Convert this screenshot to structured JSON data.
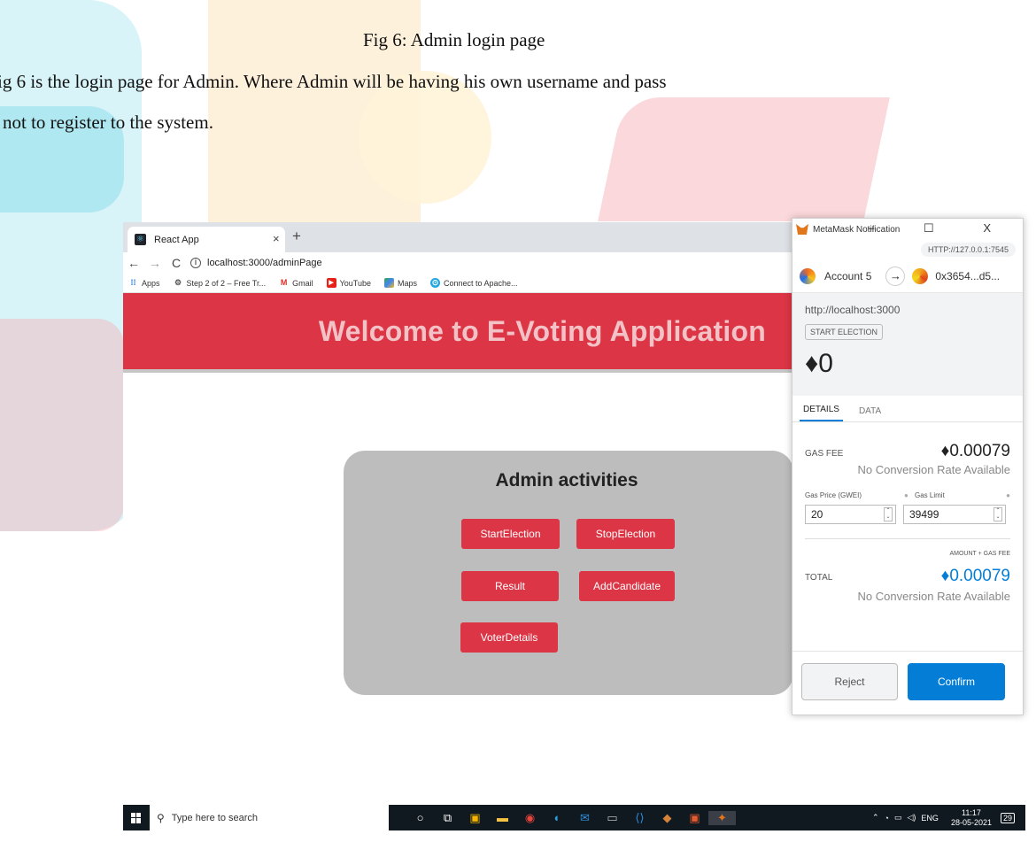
{
  "paper": {
    "caption": "Fig 6: Admin login page",
    "line1": "ig 6 is the login page for Admin. Where Admin will be having his own username and pass",
    "line2": "not to register to the system."
  },
  "browser": {
    "tab_title": "React App",
    "tab_close": "×",
    "new_tab": "+",
    "url": "localhost:3000/adminPage",
    "bookmarks": [
      {
        "label": "Apps",
        "icon": "apps-grid-icon"
      },
      {
        "label": "Step 2 of 2 – Free Tr...",
        "icon": "gear-icon"
      },
      {
        "label": "Gmail",
        "icon": "gmail-icon"
      },
      {
        "label": "YouTube",
        "icon": "youtube-icon"
      },
      {
        "label": "Maps",
        "icon": "maps-icon"
      },
      {
        "label": "Connect to Apache...",
        "icon": "apache-icon"
      }
    ]
  },
  "app": {
    "header_title": "Welcome to E-Voting Application",
    "card_title": "Admin activities",
    "buttons": {
      "start": "StartElection",
      "stop": "StopElection",
      "result": "Result",
      "add_candidate": "AddCandidate",
      "voter_details": "VoterDetails"
    },
    "accent_color": "#dc3545"
  },
  "metamask": {
    "window_title": "MetaMask Notification",
    "window_controls": "– ☐ X",
    "network": "HTTP://127.0.0.1:7545",
    "from_account": "Account 5",
    "to_address": "0x3654...d5...",
    "origin": "http://localhost:3000",
    "method": "START ELECTION",
    "value": "♦0",
    "tabs": [
      "DETAILS",
      "DATA"
    ],
    "gas_fee_label": "GAS FEE",
    "gas_fee_value": "♦0.00079",
    "no_conversion": "No Conversion Rate Available",
    "gas_price_label": "Gas Price (GWEI)",
    "gas_limit_label": "Gas Limit",
    "gas_price": "20",
    "gas_limit": "39499",
    "amount_gas_fee_label": "AMOUNT + GAS FEE",
    "total_label": "TOTAL",
    "total_value": "♦0.00079",
    "total_no_conversion": "No Conversion Rate Available",
    "reject": "Reject",
    "confirm": "Confirm",
    "confirm_color": "#037dd6"
  },
  "taskbar": {
    "search_placeholder": "Type here to search",
    "language": "ENG",
    "time": "11:17",
    "date": "28-05-2021",
    "notifications": "29"
  }
}
